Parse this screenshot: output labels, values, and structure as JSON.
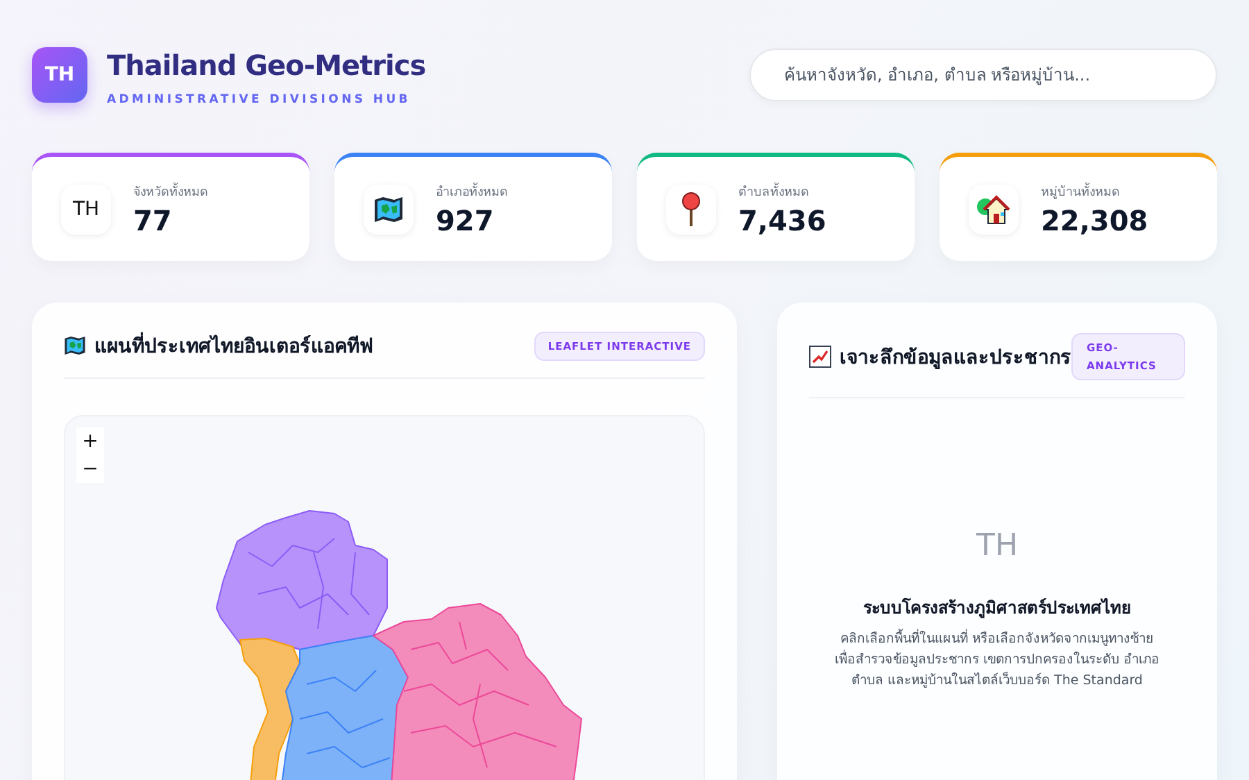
{
  "header": {
    "logo": "TH",
    "title": "Thailand Geo-Metrics",
    "subtitle": "ADMINISTRATIVE DIVISIONS HUB"
  },
  "search": {
    "placeholder": "ค้นหาจังหวัด, อำเภอ, ตำบล หรือหมู่บ้าน..."
  },
  "stats": [
    {
      "kind": "text",
      "icon_text": "TH",
      "label": "จังหวัดทั้งหมด",
      "value": "77",
      "color": "#a855f7"
    },
    {
      "kind": "map",
      "label": "อำเภอทั้งหมด",
      "value": "927",
      "color": "#3b82f6"
    },
    {
      "kind": "pin",
      "label": "ตำบลทั้งหมด",
      "value": "7,436",
      "color": "#10b981"
    },
    {
      "kind": "house",
      "label": "หมู่บ้านทั้งหมด",
      "value": "22,308",
      "color": "#f59e0b"
    }
  ],
  "map_panel": {
    "title": "แผนที่ประเทศไทยอินเตอร์แอคทีฟ",
    "badge": "LEAFLET INTERACTIVE",
    "zoom_in": "+",
    "zoom_out": "−"
  },
  "detail_panel": {
    "title": "เจาะลึกข้อมูลและประชากร",
    "badge": "GEO-ANALYTICS",
    "placeholder_icon": "TH",
    "heading": "ระบบโครงสร้างภูมิศาสตร์ประเทศไทย",
    "text": "คลิกเลือกพื้นที่ในแผนที่ หรือเลือกจังหวัดจากเมนูทางซ้าย เพื่อสำรวจข้อมูลประชากร เขตการปกครองในระดับ อำเภอ ตำบล และหมู่บ้านในสไตล์เว็บบอร์ด The Standard"
  }
}
